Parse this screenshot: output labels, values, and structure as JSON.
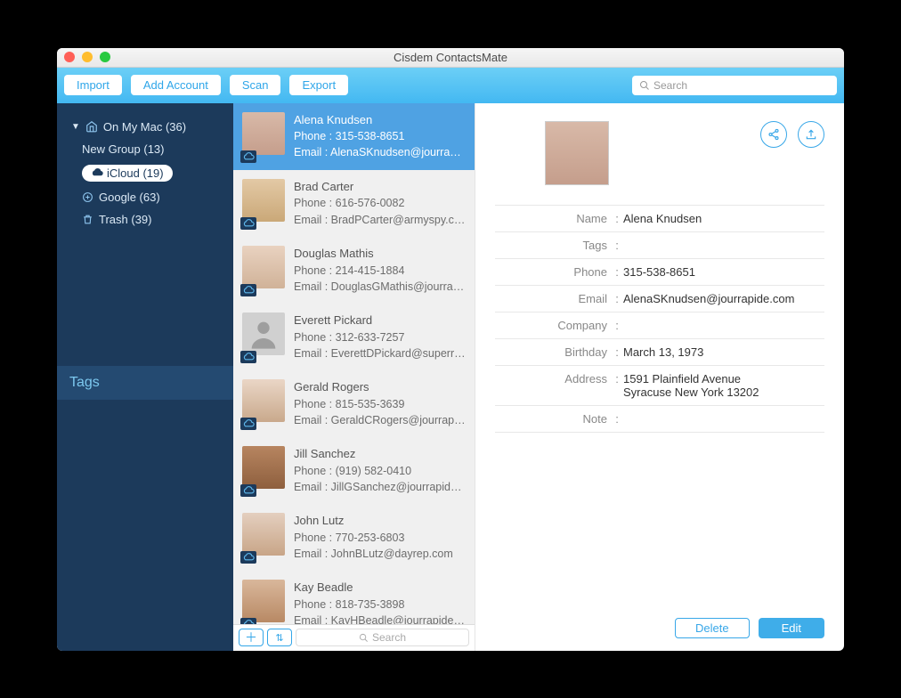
{
  "app": {
    "title": "Cisdem ContactsMate"
  },
  "toolbar": {
    "import": "Import",
    "add_account": "Add Account",
    "scan": "Scan",
    "export": "Export",
    "search_placeholder": "Search"
  },
  "sidebar": {
    "items": [
      {
        "label": "On My Mac (36)",
        "icon": "home",
        "expandable": true
      },
      {
        "label": "New Group (13)",
        "icon": null
      },
      {
        "label": "iCloud (19)",
        "icon": "cloud",
        "active": true
      },
      {
        "label": "Google (63)",
        "icon": "google"
      },
      {
        "label": "Trash (39)",
        "icon": "trash"
      }
    ],
    "tags_label": "Tags"
  },
  "contacts": [
    {
      "name": "Alena Knudsen",
      "phone": "315-538-8651",
      "email": "AlenaSKnudsen@jourrapide...",
      "selected": true,
      "avatar_class": "f1"
    },
    {
      "name": "Brad Carter",
      "phone": "616-576-0082",
      "email": "BradPCarter@armyspy.com",
      "avatar_class": "f2"
    },
    {
      "name": "Douglas Mathis",
      "phone": "214-415-1884",
      "email": "DouglasGMathis@jourrapid...",
      "avatar_class": "f3"
    },
    {
      "name": "Everett Pickard",
      "phone": "312-633-7257",
      "email": "EverettDPickard@superrito...",
      "avatar_class": "f4",
      "placeholder": true
    },
    {
      "name": "Gerald Rogers",
      "phone": "815-535-3639",
      "email": "GeraldCRogers@jourrapide...",
      "avatar_class": "f5"
    },
    {
      "name": "Jill Sanchez",
      "phone": "(919) 582-0410",
      "email": "JillGSanchez@jourrapide.com",
      "avatar_class": "f6"
    },
    {
      "name": "John Lutz",
      "phone": "770-253-6803",
      "email": "JohnBLutz@dayrep.com",
      "avatar_class": "f7"
    },
    {
      "name": "Kay Beadle",
      "phone": "818-735-3898",
      "email": "KayHBeadle@jourrapide.com",
      "avatar_class": "f8"
    }
  ],
  "list_footer": {
    "search_placeholder": "Search"
  },
  "detail": {
    "fields": {
      "name_label": "Name",
      "name_value": "Alena Knudsen",
      "tags_label": "Tags",
      "tags_value": "",
      "phone_label": "Phone",
      "phone_value": "315-538-8651",
      "email_label": "Email",
      "email_value": "AlenaSKnudsen@jourrapide.com",
      "company_label": "Company",
      "company_value": "",
      "birthday_label": "Birthday",
      "birthday_value": "March 13, 1973",
      "address_label": "Address",
      "address_value": "1591 Plainfield Avenue\nSyracuse New York 13202",
      "note_label": "Note",
      "note_value": ""
    },
    "delete": "Delete",
    "edit": "Edit"
  }
}
